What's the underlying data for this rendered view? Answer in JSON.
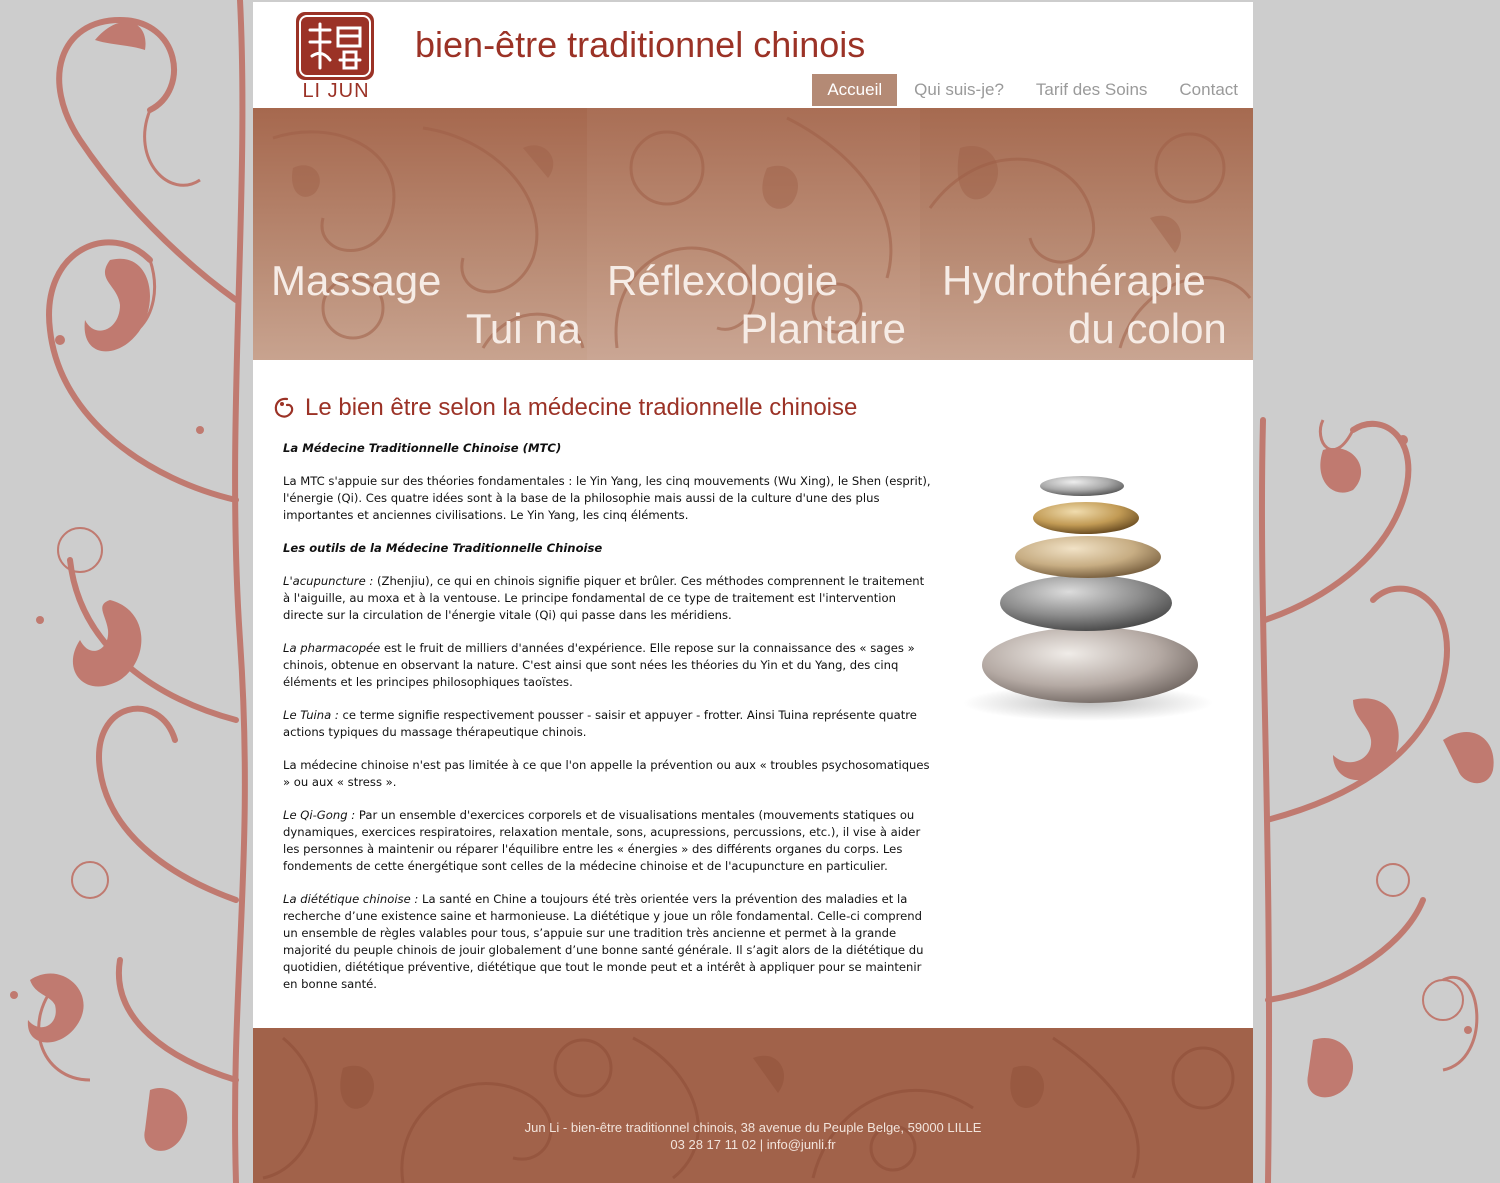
{
  "header": {
    "logo_text": "LI JUN",
    "site_title": "bien-être traditionnel chinois"
  },
  "nav": {
    "items": [
      "Accueil",
      "Qui suis-je?",
      "Tarif des Soins",
      "Contact"
    ],
    "active": "Accueil"
  },
  "banner": {
    "panels": [
      {
        "line1": "Massage",
        "line2": "Tui na"
      },
      {
        "line1": "Réflexologie",
        "line2": "Plantaire"
      },
      {
        "line1": "Hydrothérapie",
        "line2": "du colon"
      }
    ]
  },
  "main": {
    "title": "Le bien être selon la médecine tradionnelle chinoise",
    "mtc_heading": "La Médecine Traditionnelle Chinoise (MTC)",
    "mtc_text": "La MTC s'appuie sur des théories fondamentales : le Yin Yang, les cinq mouvements (Wu Xing), le Shen (esprit), l'énergie (Qi). Ces quatre idées sont à la base de la philosophie mais aussi de la culture d'une des plus importantes et anciennes civilisations. Le Yin Yang, les cinq éléments.",
    "tools_heading": "Les outils de la Médecine Traditionnelle Chinoise",
    "acupuncture_term": "L'acupuncture :",
    "acupuncture_text": " (Zhenjiu), ce qui en chinois signifie piquer et brûler. Ces méthodes comprennent le traitement à l'aiguille, au moxa et à la ventouse. Le principe fondamental de ce type de traitement est l'intervention directe sur la circulation de l'énergie vitale (Qi) qui passe dans les méridiens.",
    "pharma_term": "La pharmacopée",
    "pharma_text": " est le fruit de milliers d'années d'expérience. Elle repose sur la connaissance des « sages » chinois, obtenue en observant la nature. C'est ainsi que sont nées les théories du Yin et du Yang, des cinq éléments et les principes philosophiques taoïstes.",
    "tuina_term": "Le Tuina :",
    "tuina_text": " ce terme signifie respectivement pousser - saisir et appuyer - frotter. Ainsi Tuina représente quatre actions typiques du massage thérapeutique chinois.",
    "prevention_text": "La médecine chinoise n'est pas limitée à ce que l'on appelle la prévention ou aux « troubles psychosomatiques » ou aux « stress ».",
    "qigong_term": "Le Qi-Gong :",
    "qigong_text": " Par un ensemble d'exercices corporels et de visualisations mentales (mouvements statiques ou dynamiques, exercices respiratoires, relaxation mentale, sons, acupressions, percussions, etc.), il vise à aider les personnes à maintenir ou réparer l'équilibre entre les « énergies » des différents organes du corps. Les fondements de cette énergétique sont celles de la médecine chinoise et de l'acupuncture en particulier.",
    "diet_term": "La diététique chinoise :",
    "diet_text": " La santé en Chine a toujours été très orientée vers la prévention des maladies et la recherche d’une existence saine et harmonieuse. La diététique y joue un rôle fondamental. Celle-ci comprend un ensemble de règles valables pour tous, s’appuie sur une tradition très ancienne et permet à la grande majorité du peuple chinois de jouir globalement d’une bonne santé générale. Il s’agit alors de la diététique du quotidien, diététique préventive, diététique que tout le monde peut et a intérêt à appliquer pour se maintenir en bonne santé."
  },
  "footer": {
    "line1": "Jun Li - bien-être traditionnel chinois,  38 avenue du Peuple Belge, 59000 LILLE",
    "line2": "03 28 17 11 02  |  info@junli.fr"
  },
  "colors": {
    "brand_red": "#9b3226",
    "nav_active_bg": "#b48a75",
    "banner_brown": "#b07a63",
    "background_grey": "#cdcdcd",
    "ornament": "#c07a70"
  }
}
